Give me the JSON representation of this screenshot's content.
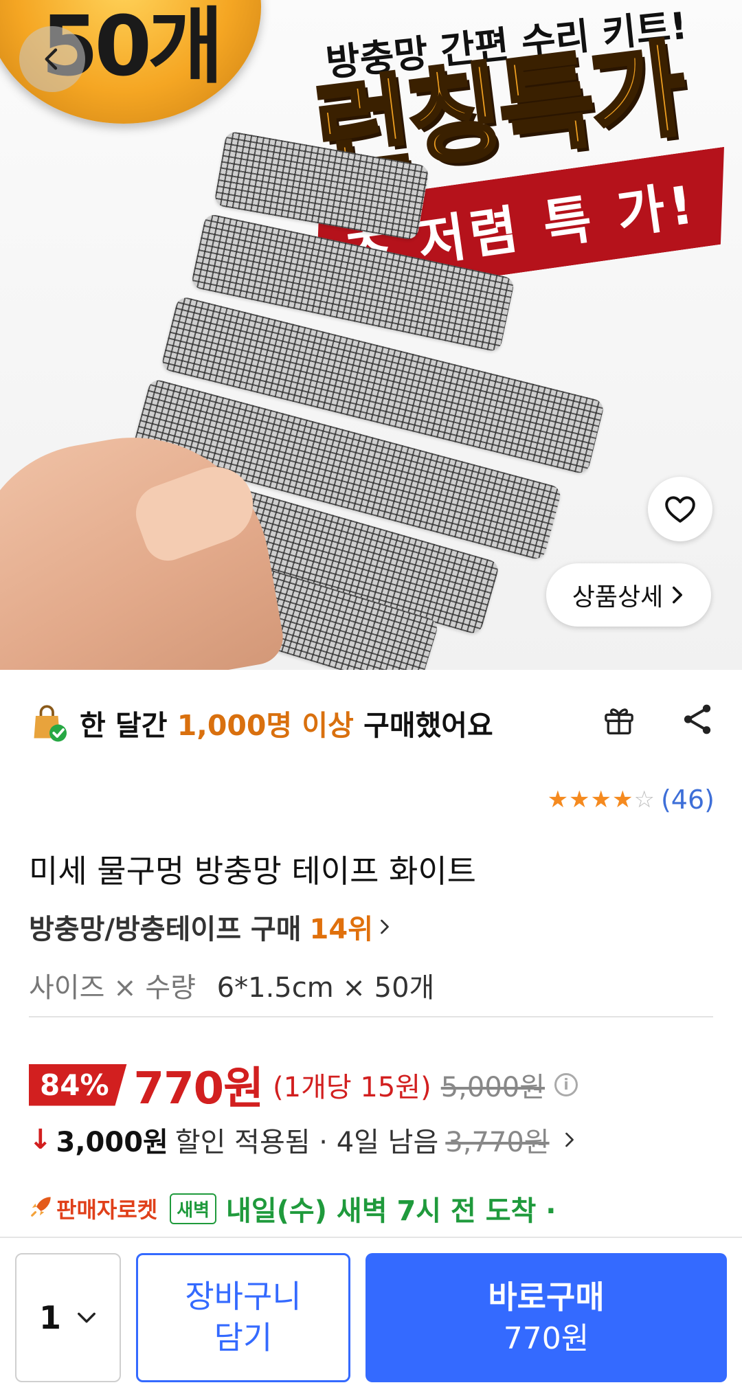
{
  "hero": {
    "badge_text": "50개",
    "headline_top": "방충망 간편 수리 키트!",
    "headline_main": "런칭특가",
    "ribbon_text": "초 저렴 특 가!",
    "detail_button": "상품상세"
  },
  "social_proof": {
    "prefix": "한 달간",
    "highlight": "1,000명 이상",
    "suffix": "구매했어요"
  },
  "rating": {
    "stars": 4,
    "max_stars": 5,
    "count": "(46)"
  },
  "product": {
    "title": "미세 물구멍 방충망 테이프 화이트",
    "category_rank_label": "방충망/방충테이프 구매",
    "category_rank_value": "14위",
    "option_label": "사이즈 × 수량",
    "option_value": "6*1.5cm × 50개"
  },
  "price": {
    "discount": "84%",
    "sale_price": "770원",
    "unit_price": "(1개당 15원)",
    "original_price": "5,000원",
    "info_icon": "i"
  },
  "coupon": {
    "arrow": "↓",
    "amount": "3,000원",
    "text": "할인 적용됨 · 4일 남음",
    "previous_price": "3,770원"
  },
  "delivery": {
    "seller_rocket": "판매자로켓",
    "dawn_badge": "새벽",
    "text": "내일(수) 새벽 7시 전 도착 ·"
  },
  "bottom_bar": {
    "quantity": "1",
    "cart_line1": "장바구니",
    "cart_line2": "담기",
    "buy_label": "바로구매",
    "buy_price": "770원"
  },
  "colors": {
    "accent_blue": "#346aff",
    "discount_red": "#d21f1f",
    "highlight_orange": "#d9700e",
    "delivery_green": "#1f9a3c"
  }
}
